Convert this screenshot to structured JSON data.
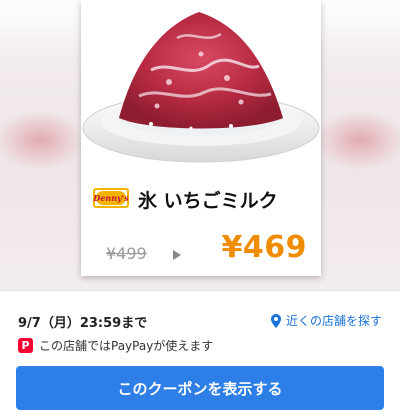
{
  "coupon": {
    "brand_logo": "Denny's",
    "product_name": "氷 いちごミルク",
    "old_price": "¥499",
    "new_price": "¥469",
    "accent_color": "#f08c00"
  },
  "info": {
    "deadline": "9/7（月）23:59まで",
    "find_store_label": "近くの店舗を探す",
    "paypay_text": "この店舗ではPayPayが使えます",
    "show_coupon_button": "このクーポンを表示する",
    "button_color": "#2d7ee6",
    "link_color": "#1a73d9"
  },
  "icons": {
    "location": "map-pin-icon",
    "paypay": "paypay-icon",
    "arrow": "arrow-right-icon"
  }
}
